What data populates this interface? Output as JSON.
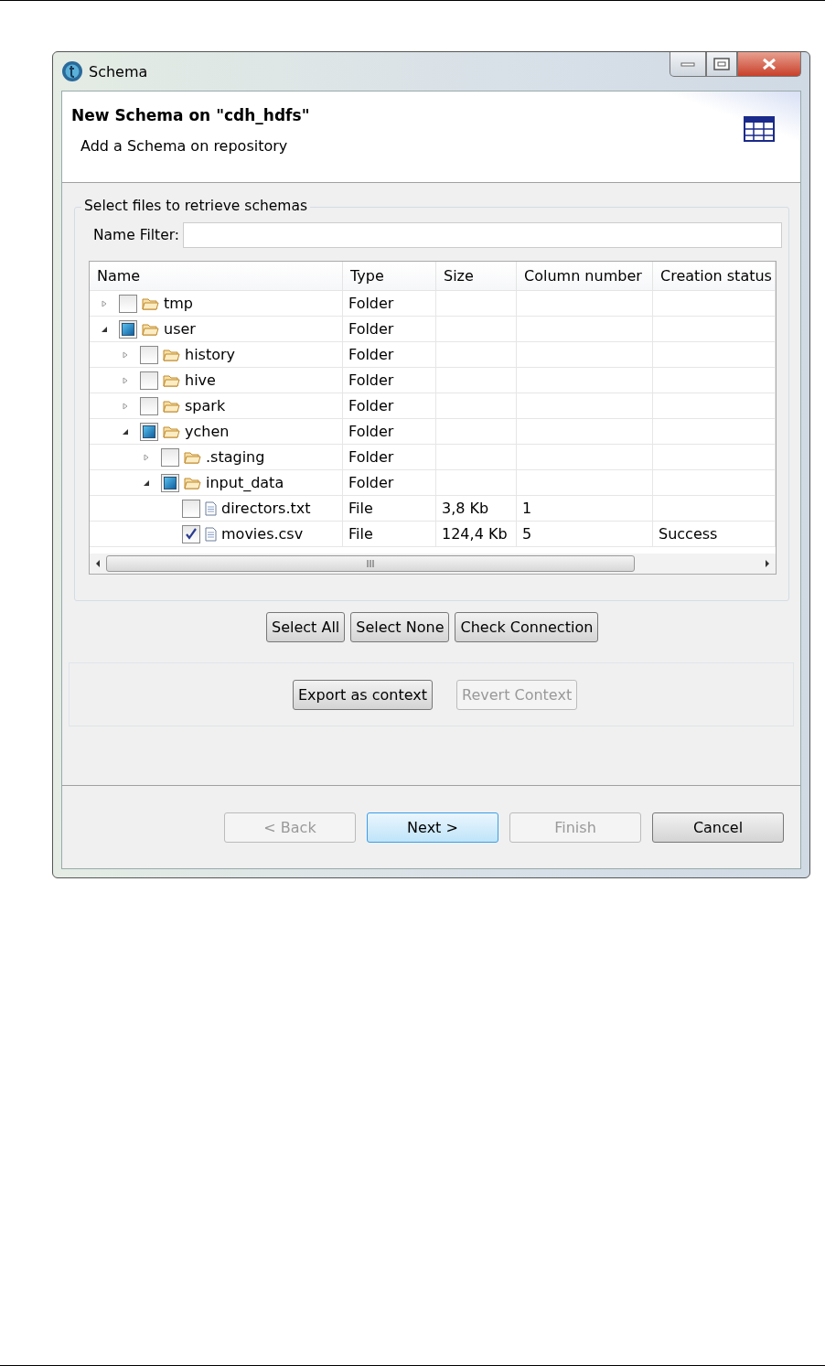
{
  "window": {
    "title": "Schema"
  },
  "header": {
    "title": "New Schema on \"cdh_hdfs\"",
    "subtitle": "Add a Schema on repository"
  },
  "group": {
    "title": "Select files to retrieve schemas",
    "filter": {
      "label": "Name Filter:"
    }
  },
  "table": {
    "columns": [
      "Name",
      "Type",
      "Size",
      "Column number",
      "Creation status"
    ],
    "rows": [
      {
        "name": "tmp",
        "kind": "folder",
        "partial": false,
        "expanded": false,
        "type": "Folder"
      },
      {
        "name": "user",
        "kind": "folder",
        "partial": true,
        "expanded": true,
        "type": "Folder",
        "children": [
          {
            "name": "history",
            "kind": "folder",
            "partial": false,
            "expanded": false,
            "type": "Folder"
          },
          {
            "name": "hive",
            "kind": "folder",
            "partial": false,
            "expanded": false,
            "type": "Folder"
          },
          {
            "name": "spark",
            "kind": "folder",
            "partial": false,
            "expanded": false,
            "type": "Folder"
          },
          {
            "name": "ychen",
            "kind": "folder",
            "partial": true,
            "expanded": true,
            "type": "Folder",
            "children": [
              {
                "name": ".staging",
                "kind": "folder",
                "partial": false,
                "expanded": false,
                "type": "Folder"
              },
              {
                "name": "input_data",
                "kind": "folder",
                "partial": true,
                "expanded": true,
                "type": "Folder",
                "children": [
                  {
                    "name": "directors.txt",
                    "kind": "file",
                    "checked": false,
                    "type": "File",
                    "size": "3,8 Kb",
                    "columns": "1"
                  },
                  {
                    "name": "movies.csv",
                    "kind": "file",
                    "checked": true,
                    "type": "File",
                    "size": "124,4 Kb",
                    "columns": "5",
                    "status": "Success"
                  }
                ]
              }
            ]
          }
        ]
      }
    ]
  },
  "selection_buttons": [
    {
      "label": "Select All",
      "disabled": false
    },
    {
      "label": "Select None",
      "disabled": false
    },
    {
      "label": "Check Connection",
      "disabled": false
    }
  ],
  "context_buttons": [
    {
      "label": "Export as context",
      "disabled": false
    },
    {
      "label": "Revert Context",
      "disabled": true
    }
  ],
  "nav_buttons": [
    {
      "label": "< Back",
      "disabled": true,
      "default": false
    },
    {
      "label": "Next >",
      "disabled": false,
      "default": true
    },
    {
      "label": "Finish",
      "disabled": true,
      "default": false
    },
    {
      "label": "Cancel",
      "disabled": false,
      "default": false
    }
  ]
}
